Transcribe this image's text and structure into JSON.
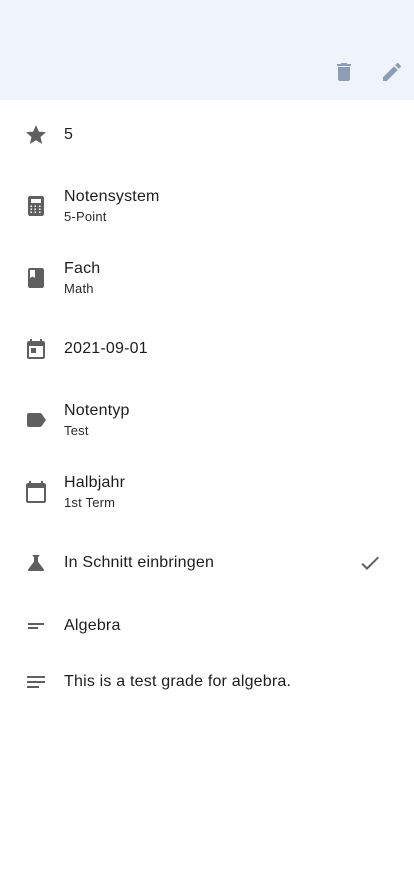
{
  "header": {
    "delete_icon": "delete-icon",
    "edit_icon": "edit-icon",
    "background_color": "#eef3fc",
    "icon_color": "#8c9db5"
  },
  "details": {
    "grade": {
      "icon": "star-icon",
      "value": "5"
    },
    "grading_system": {
      "icon": "calculator-icon",
      "label": "Notensystem",
      "value": "5-Point"
    },
    "subject": {
      "icon": "book-icon",
      "label": "Fach",
      "value": "Math"
    },
    "date": {
      "icon": "calendar-today-icon",
      "value": "2021-09-01"
    },
    "grade_type": {
      "icon": "label-icon",
      "label": "Notentyp",
      "value": "Test"
    },
    "term": {
      "icon": "calendar-icon",
      "label": "Halbjahr",
      "value": "1st Term"
    },
    "include_in_average": {
      "icon": "flask-icon",
      "label": "In Schnitt einbringen",
      "checked": true,
      "check_icon": "check-icon"
    },
    "topic": {
      "icon": "short-text-icon",
      "value": "Algebra"
    },
    "description": {
      "icon": "notes-icon",
      "value": "This is a test grade for algebra."
    }
  }
}
